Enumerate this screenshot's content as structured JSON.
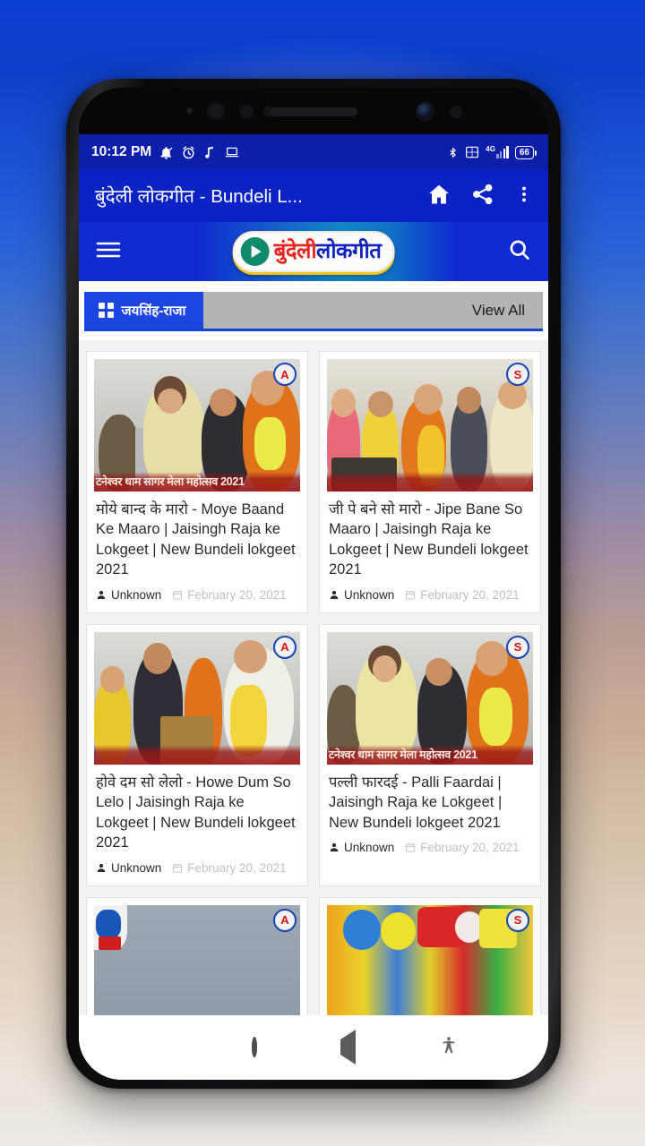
{
  "status_bar": {
    "time": "10:12 PM",
    "left_icons": [
      "mute-icon",
      "alarm-icon",
      "music-note-icon",
      "laptop-icon"
    ],
    "right_icons": [
      "bluetooth-icon",
      "dual-sim-icon",
      "network-4g-icon"
    ],
    "network_label": "4G",
    "battery_level": "66"
  },
  "app_bar": {
    "title": "बुंदेली लोकगीत - Bundeli L...",
    "actions": [
      "home-icon",
      "share-icon",
      "overflow-menu-icon"
    ]
  },
  "logo_bar": {
    "menu_icon": "hamburger-menu-icon",
    "logo_text_primary": "बुंदेली",
    "logo_text_secondary": "लोकगीत",
    "search_icon": "search-icon"
  },
  "category_bar": {
    "tab_label": "जयसिंह-राजा",
    "tab_icon": "grid-icon",
    "view_all_label": "View All"
  },
  "cards": [
    {
      "title": "मोये बान्द के मारो - Moye Baand Ke Maaro | Jaisingh Raja ke Lokgeet | New Bundeli lokgeet 2021",
      "author": "Unknown",
      "date": "February 20, 2021",
      "thumb_caption": "टनेश्वर धाम सागर मेला महोत्सव 2021",
      "thumb_badge": "A"
    },
    {
      "title": "जी पे बने सो मारो - Jipe Bane So Maaro | Jaisingh Raja ke Lokgeet | New Bundeli lokgeet 2021",
      "author": "Unknown",
      "date": "February 20, 2021",
      "thumb_caption": "",
      "thumb_badge": "S"
    },
    {
      "title": "होवे दम सो लेलो - Howe Dum So Lelo | Jaisingh Raja ke Lokgeet | New Bundeli lokgeet 2021",
      "author": "Unknown",
      "date": "February 20, 2021",
      "thumb_caption": "",
      "thumb_badge": "A"
    },
    {
      "title": "पल्ली फारदई - Palli Faardai | Jaisingh Raja ke Lokgeet | New Bundeli lokgeet 2021",
      "author": "Unknown",
      "date": "February 20, 2021",
      "thumb_caption": "टनेश्वर धाम सागर मेला महोत्सव 2021",
      "thumb_badge": "S"
    },
    {
      "title": "",
      "author": "",
      "date": "",
      "thumb_caption": "",
      "thumb_badge": "A"
    },
    {
      "title": "",
      "author": "",
      "date": "",
      "thumb_caption": "",
      "thumb_badge": "S"
    }
  ],
  "nav_bar": {
    "items": [
      "recents-button",
      "home-button",
      "back-button",
      "accessibility-button"
    ]
  },
  "colors": {
    "status_bar": "#0b1fa8",
    "app_bar": "#0b23c4",
    "accent_tab": "#1a45e0",
    "logo_red": "#e8241f",
    "logo_blue": "#1024bd",
    "page_bg": "#f2f2f2"
  }
}
